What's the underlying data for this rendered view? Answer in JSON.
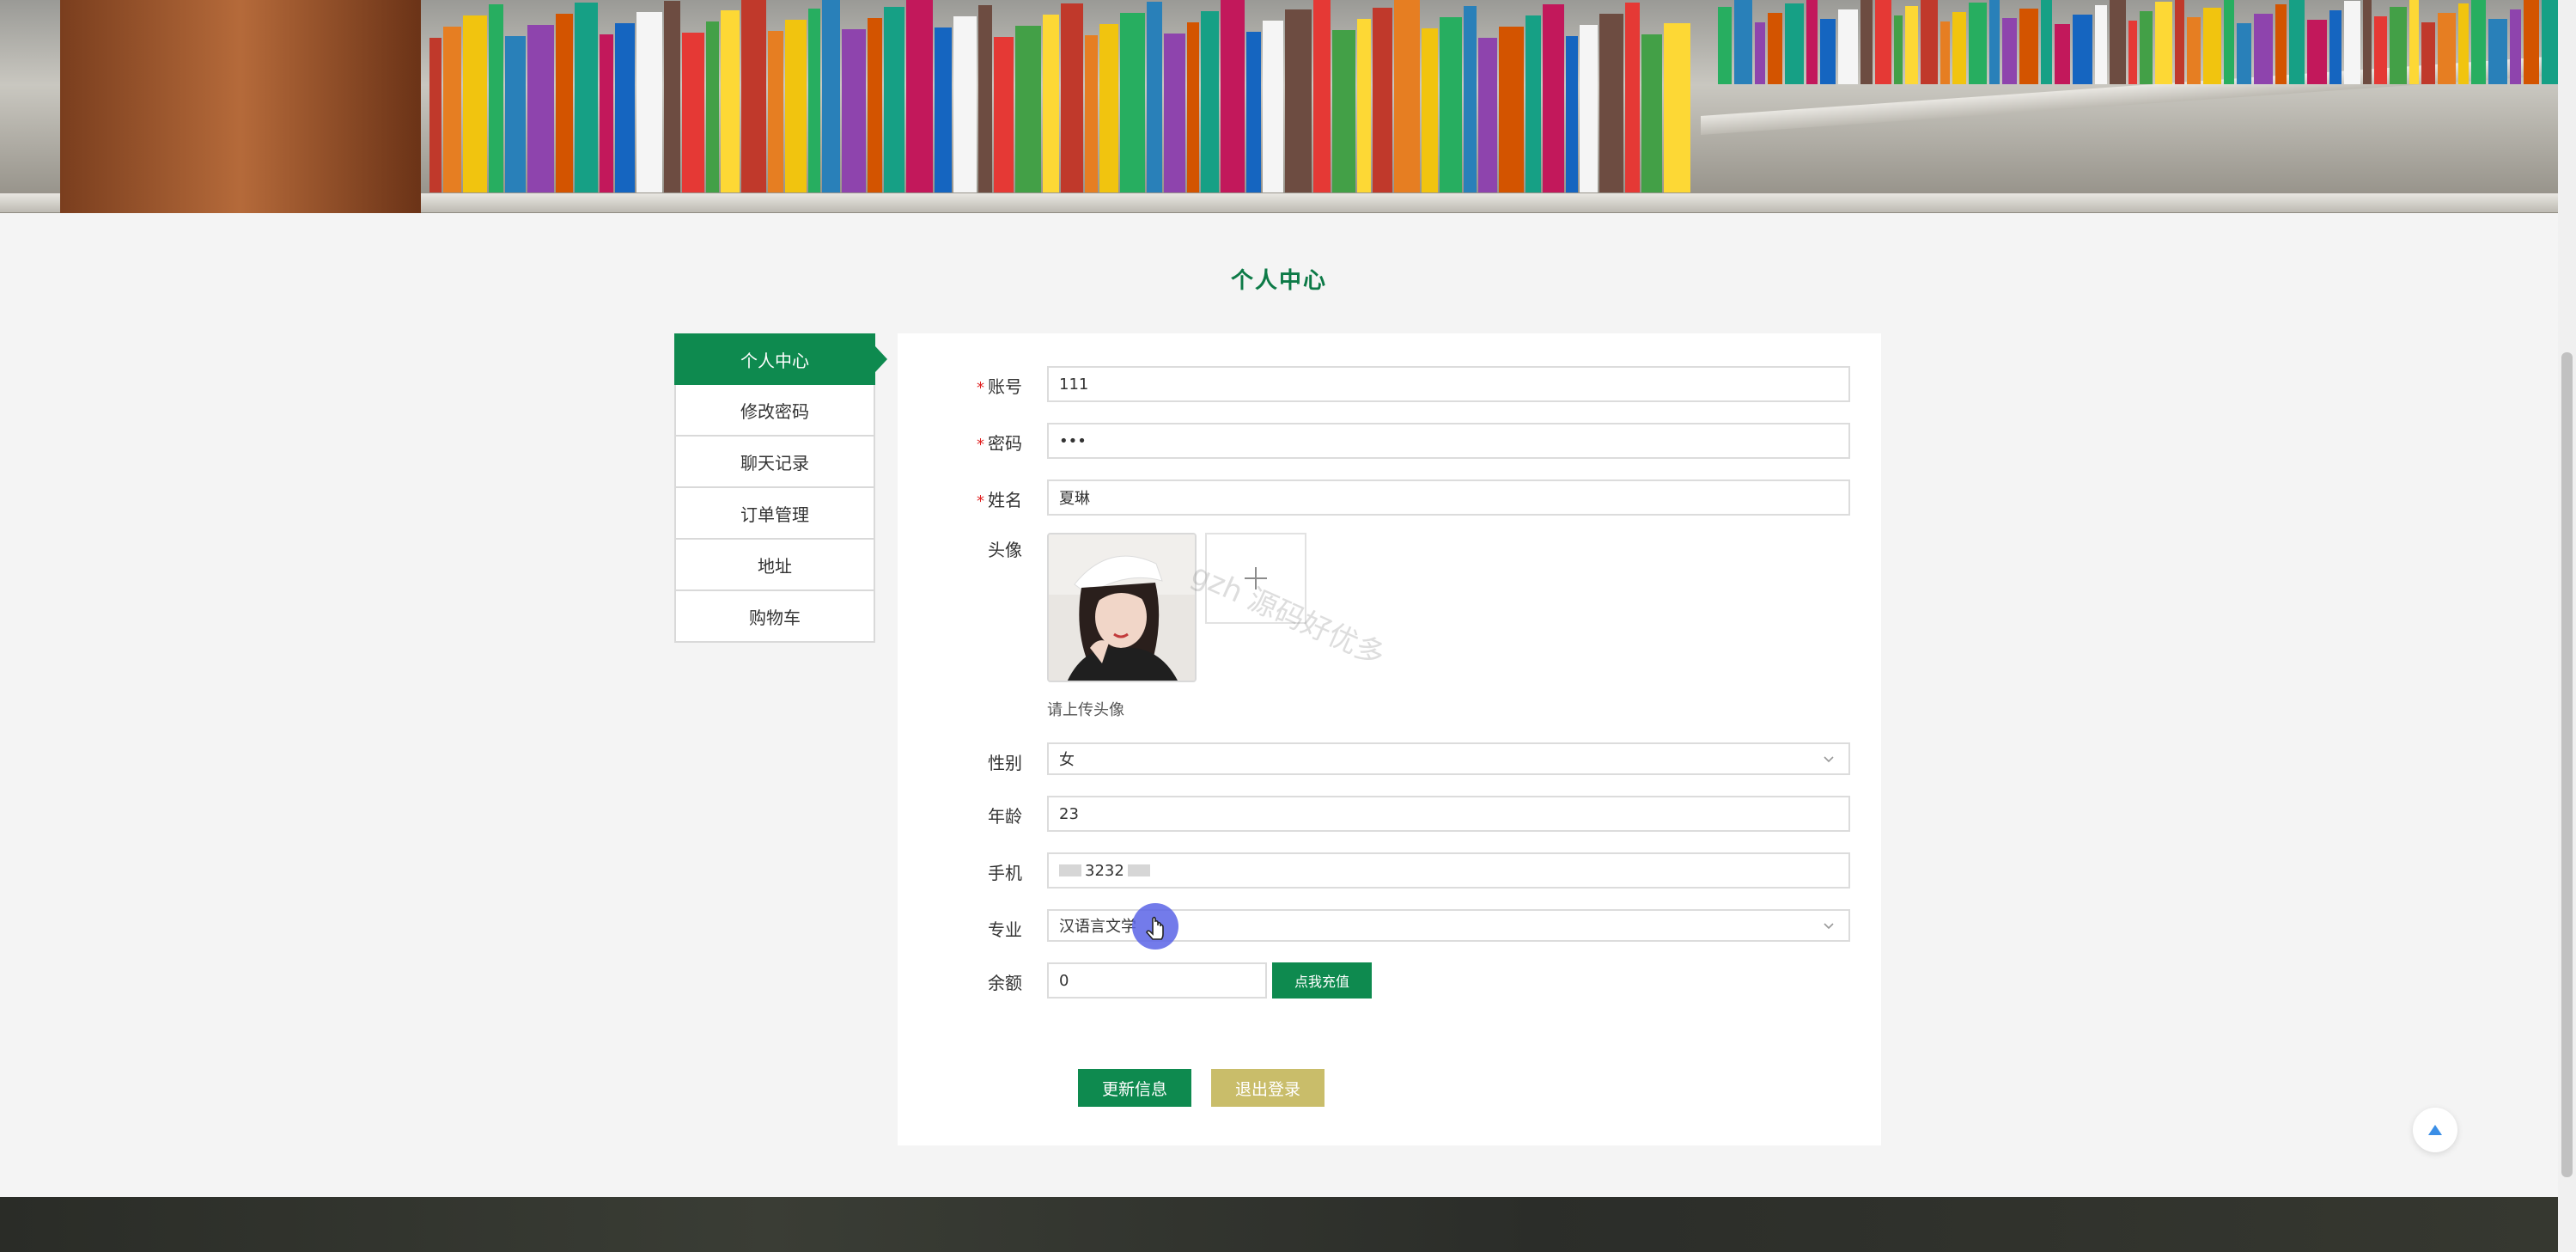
{
  "page": {
    "title": "个人中心"
  },
  "sidebar": {
    "items": [
      {
        "label": "个人中心",
        "active": true
      },
      {
        "label": "修改密码",
        "active": false
      },
      {
        "label": "聊天记录",
        "active": false
      },
      {
        "label": "订单管理",
        "active": false
      },
      {
        "label": "地址",
        "active": false
      },
      {
        "label": "购物车",
        "active": false
      }
    ]
  },
  "form": {
    "account": {
      "label": "账号",
      "required": true,
      "value": "111"
    },
    "password": {
      "label": "密码",
      "required": true,
      "value": "•••"
    },
    "name": {
      "label": "姓名",
      "required": true,
      "value": "夏琳"
    },
    "avatar": {
      "label": "头像",
      "hint": "请上传头像",
      "upload_icon": "plus-icon"
    },
    "gender": {
      "label": "性别",
      "value": "女"
    },
    "age": {
      "label": "年龄",
      "value": "23"
    },
    "phone": {
      "label": "手机",
      "value": "3232"
    },
    "major": {
      "label": "专业",
      "value": "汉语言文学"
    },
    "balance": {
      "label": "余额",
      "value": "0",
      "recharge_label": "点我充值"
    }
  },
  "actions": {
    "update_label": "更新信息",
    "logout_label": "退出登录"
  },
  "watermark": "gzh 源码好优多",
  "colors": {
    "primary": "#0e8a4f",
    "logout": "#c9bd6a",
    "required": "#e02020"
  }
}
